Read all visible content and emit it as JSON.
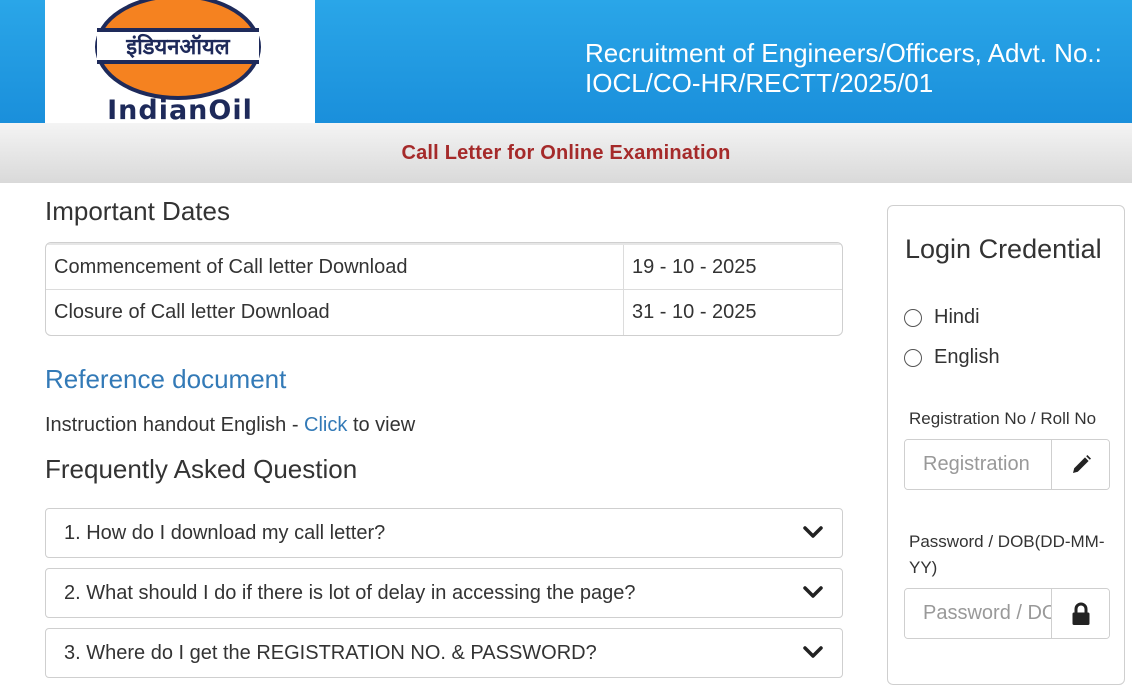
{
  "header": {
    "logo_hindi": "इंडियनऑयल",
    "logo_name": "IndianOil",
    "title": "Recruitment of Engineers/Officers, Advt. No.: IOCL/CO-HR/RECTT/2025/01"
  },
  "subbar": {
    "title": "Call Letter for Online Examination"
  },
  "important_dates": {
    "heading": "Important Dates",
    "rows": [
      {
        "label": "Commencement of Call letter Download",
        "date": "19 - 10 - 2025"
      },
      {
        "label": "Closure of Call letter Download",
        "date": "31 - 10 - 2025"
      }
    ]
  },
  "reference": {
    "heading": "Reference document",
    "instruction_prefix": "Instruction handout English - ",
    "link_text": "Click",
    "instruction_suffix": " to view"
  },
  "faq": {
    "heading": "Frequently Asked Question",
    "items": [
      "1. How do I download my call letter?",
      "2. What should I do if there is lot of delay in accessing the page?",
      "3. Where do I get the REGISTRATION NO. & PASSWORD?"
    ]
  },
  "login": {
    "heading": "Login Credential",
    "languages": [
      "Hindi",
      "English"
    ],
    "reg_label": "Registration No / Roll No",
    "reg_placeholder": "Registration",
    "pwd_label": "Password / DOB(DD-MM-YY)",
    "pwd_placeholder": "Password / DOB"
  },
  "colors": {
    "header_blue": "#1a8fdb",
    "subbar_title": "#a52a2a",
    "link_blue": "#337ab7",
    "logo_orange": "#f58220",
    "logo_navy": "#1e2a5a"
  },
  "icons": {
    "reg_addon": "pencil-icon",
    "pwd_addon": "lock-icon",
    "faq_toggle": "chevron-down-icon"
  }
}
